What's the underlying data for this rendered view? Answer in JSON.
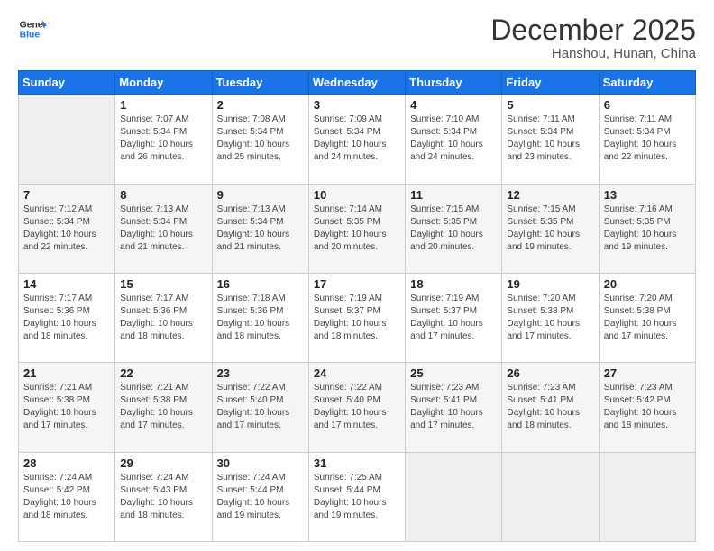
{
  "logo": {
    "line1": "General",
    "line2": "Blue"
  },
  "title": "December 2025",
  "location": "Hanshou, Hunan, China",
  "days_of_week": [
    "Sunday",
    "Monday",
    "Tuesday",
    "Wednesday",
    "Thursday",
    "Friday",
    "Saturday"
  ],
  "weeks": [
    [
      {
        "day": "",
        "sunrise": "",
        "sunset": "",
        "daylight": ""
      },
      {
        "day": "1",
        "sunrise": "Sunrise: 7:07 AM",
        "sunset": "Sunset: 5:34 PM",
        "daylight": "Daylight: 10 hours and 26 minutes."
      },
      {
        "day": "2",
        "sunrise": "Sunrise: 7:08 AM",
        "sunset": "Sunset: 5:34 PM",
        "daylight": "Daylight: 10 hours and 25 minutes."
      },
      {
        "day": "3",
        "sunrise": "Sunrise: 7:09 AM",
        "sunset": "Sunset: 5:34 PM",
        "daylight": "Daylight: 10 hours and 24 minutes."
      },
      {
        "day": "4",
        "sunrise": "Sunrise: 7:10 AM",
        "sunset": "Sunset: 5:34 PM",
        "daylight": "Daylight: 10 hours and 24 minutes."
      },
      {
        "day": "5",
        "sunrise": "Sunrise: 7:11 AM",
        "sunset": "Sunset: 5:34 PM",
        "daylight": "Daylight: 10 hours and 23 minutes."
      },
      {
        "day": "6",
        "sunrise": "Sunrise: 7:11 AM",
        "sunset": "Sunset: 5:34 PM",
        "daylight": "Daylight: 10 hours and 22 minutes."
      }
    ],
    [
      {
        "day": "7",
        "sunrise": "Sunrise: 7:12 AM",
        "sunset": "Sunset: 5:34 PM",
        "daylight": "Daylight: 10 hours and 22 minutes."
      },
      {
        "day": "8",
        "sunrise": "Sunrise: 7:13 AM",
        "sunset": "Sunset: 5:34 PM",
        "daylight": "Daylight: 10 hours and 21 minutes."
      },
      {
        "day": "9",
        "sunrise": "Sunrise: 7:13 AM",
        "sunset": "Sunset: 5:34 PM",
        "daylight": "Daylight: 10 hours and 21 minutes."
      },
      {
        "day": "10",
        "sunrise": "Sunrise: 7:14 AM",
        "sunset": "Sunset: 5:35 PM",
        "daylight": "Daylight: 10 hours and 20 minutes."
      },
      {
        "day": "11",
        "sunrise": "Sunrise: 7:15 AM",
        "sunset": "Sunset: 5:35 PM",
        "daylight": "Daylight: 10 hours and 20 minutes."
      },
      {
        "day": "12",
        "sunrise": "Sunrise: 7:15 AM",
        "sunset": "Sunset: 5:35 PM",
        "daylight": "Daylight: 10 hours and 19 minutes."
      },
      {
        "day": "13",
        "sunrise": "Sunrise: 7:16 AM",
        "sunset": "Sunset: 5:35 PM",
        "daylight": "Daylight: 10 hours and 19 minutes."
      }
    ],
    [
      {
        "day": "14",
        "sunrise": "Sunrise: 7:17 AM",
        "sunset": "Sunset: 5:36 PM",
        "daylight": "Daylight: 10 hours and 18 minutes."
      },
      {
        "day": "15",
        "sunrise": "Sunrise: 7:17 AM",
        "sunset": "Sunset: 5:36 PM",
        "daylight": "Daylight: 10 hours and 18 minutes."
      },
      {
        "day": "16",
        "sunrise": "Sunrise: 7:18 AM",
        "sunset": "Sunset: 5:36 PM",
        "daylight": "Daylight: 10 hours and 18 minutes."
      },
      {
        "day": "17",
        "sunrise": "Sunrise: 7:19 AM",
        "sunset": "Sunset: 5:37 PM",
        "daylight": "Daylight: 10 hours and 18 minutes."
      },
      {
        "day": "18",
        "sunrise": "Sunrise: 7:19 AM",
        "sunset": "Sunset: 5:37 PM",
        "daylight": "Daylight: 10 hours and 17 minutes."
      },
      {
        "day": "19",
        "sunrise": "Sunrise: 7:20 AM",
        "sunset": "Sunset: 5:38 PM",
        "daylight": "Daylight: 10 hours and 17 minutes."
      },
      {
        "day": "20",
        "sunrise": "Sunrise: 7:20 AM",
        "sunset": "Sunset: 5:38 PM",
        "daylight": "Daylight: 10 hours and 17 minutes."
      }
    ],
    [
      {
        "day": "21",
        "sunrise": "Sunrise: 7:21 AM",
        "sunset": "Sunset: 5:38 PM",
        "daylight": "Daylight: 10 hours and 17 minutes."
      },
      {
        "day": "22",
        "sunrise": "Sunrise: 7:21 AM",
        "sunset": "Sunset: 5:38 PM",
        "daylight": "Daylight: 10 hours and 17 minutes."
      },
      {
        "day": "23",
        "sunrise": "Sunrise: 7:22 AM",
        "sunset": "Sunset: 5:40 PM",
        "daylight": "Daylight: 10 hours and 17 minutes."
      },
      {
        "day": "24",
        "sunrise": "Sunrise: 7:22 AM",
        "sunset": "Sunset: 5:40 PM",
        "daylight": "Daylight: 10 hours and 17 minutes."
      },
      {
        "day": "25",
        "sunrise": "Sunrise: 7:23 AM",
        "sunset": "Sunset: 5:41 PM",
        "daylight": "Daylight: 10 hours and 17 minutes."
      },
      {
        "day": "26",
        "sunrise": "Sunrise: 7:23 AM",
        "sunset": "Sunset: 5:41 PM",
        "daylight": "Daylight: 10 hours and 18 minutes."
      },
      {
        "day": "27",
        "sunrise": "Sunrise: 7:23 AM",
        "sunset": "Sunset: 5:42 PM",
        "daylight": "Daylight: 10 hours and 18 minutes."
      }
    ],
    [
      {
        "day": "28",
        "sunrise": "Sunrise: 7:24 AM",
        "sunset": "Sunset: 5:42 PM",
        "daylight": "Daylight: 10 hours and 18 minutes."
      },
      {
        "day": "29",
        "sunrise": "Sunrise: 7:24 AM",
        "sunset": "Sunset: 5:43 PM",
        "daylight": "Daylight: 10 hours and 18 minutes."
      },
      {
        "day": "30",
        "sunrise": "Sunrise: 7:24 AM",
        "sunset": "Sunset: 5:44 PM",
        "daylight": "Daylight: 10 hours and 19 minutes."
      },
      {
        "day": "31",
        "sunrise": "Sunrise: 7:25 AM",
        "sunset": "Sunset: 5:44 PM",
        "daylight": "Daylight: 10 hours and 19 minutes."
      },
      {
        "day": "",
        "sunrise": "",
        "sunset": "",
        "daylight": ""
      },
      {
        "day": "",
        "sunrise": "",
        "sunset": "",
        "daylight": ""
      },
      {
        "day": "",
        "sunrise": "",
        "sunset": "",
        "daylight": ""
      }
    ]
  ]
}
